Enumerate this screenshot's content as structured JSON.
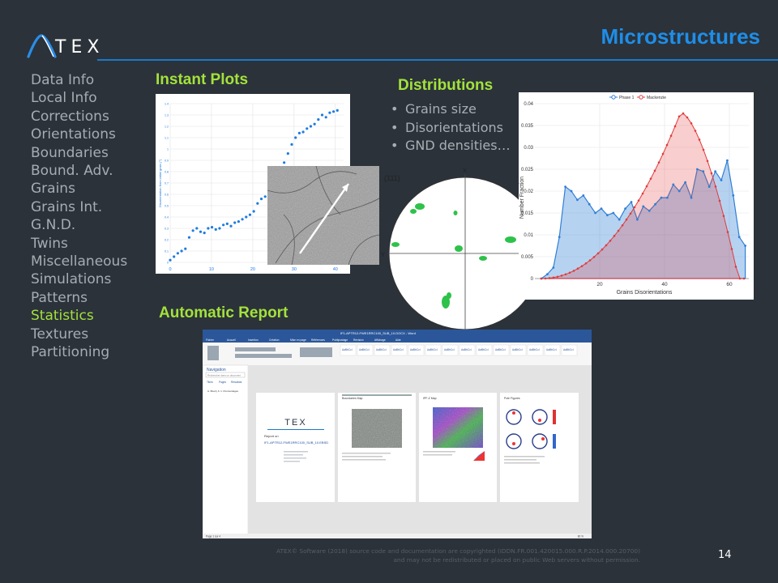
{
  "header": {
    "logo_text": "TEX",
    "title": "Microstructures"
  },
  "menu": {
    "items": [
      {
        "label": "Data Info"
      },
      {
        "label": "Local Info"
      },
      {
        "label": "Corrections"
      },
      {
        "label": "Orientations"
      },
      {
        "label": "Boundaries"
      },
      {
        "label": "Bound. Adv."
      },
      {
        "label": "Grains"
      },
      {
        "label": "Grains Int."
      },
      {
        "label": "G.N.D."
      },
      {
        "label": "Twins"
      },
      {
        "label": "Miscellaneous"
      },
      {
        "label": "Simulations"
      },
      {
        "label": "Patterns"
      },
      {
        "label": "Statistics",
        "active": true
      },
      {
        "label": "Textures"
      },
      {
        "label": "Partitioning"
      }
    ],
    "active_color": "#a3e23a"
  },
  "sections": {
    "instant_plots": "Instant Plots",
    "distributions": "Distributions",
    "automatic_report": "Automatic Report"
  },
  "distribution_bullets": [
    "Grains size",
    "Disorientations",
    "GND densities…"
  ],
  "pole_figure": {
    "label": "(111)",
    "x_axis": "X",
    "y_axis": "Y"
  },
  "chart_data": [
    {
      "type": "scatter",
      "x_ticks": [
        0,
        10,
        20,
        30,
        40
      ],
      "xlim": [
        0,
        42
      ],
      "ylim": [
        0,
        1.4
      ],
      "y_ticks": [
        0,
        0.1,
        0.2,
        0.3,
        0.4,
        0.5,
        0.6,
        0.7,
        0.8,
        0.9,
        1.0,
        1.1,
        1.2,
        1.3,
        1.4
      ],
      "color": "#1e7be0"
    },
    {
      "type": "area",
      "xlabel": "Grains Disorientations",
      "ylabel": "Number Fraction",
      "xlim": [
        0,
        66
      ],
      "ylim": [
        0,
        0.04
      ],
      "x_ticks": [
        20,
        40,
        60
      ],
      "y_ticks": [
        0,
        0.005,
        0.01,
        0.015,
        0.02,
        0.025,
        0.03,
        0.035,
        0.04
      ],
      "series": [
        {
          "name": "Phase 1",
          "color": "#2f7fd6"
        },
        {
          "name": "Mackenzie",
          "color": "#e23b3b"
        }
      ]
    }
  ],
  "report": {
    "word_title": "IF1-APTR12-FWE1RRC100_SUB_10.DOCX - Word",
    "nav_pane_title": "Navigation",
    "nav_search_placeholder": "Rechercher dans un document",
    "nav_tabs": [
      "Titres",
      "Pages",
      "Résultats"
    ],
    "nav_item": "A. Bouzy b. 1. Pourcentages",
    "ribbon_tabs": [
      "Fichier",
      "Accueil",
      "Insertion",
      "Création",
      "Mise en page",
      "Références",
      "Publipostage",
      "Révision",
      "Affichage",
      "Aide"
    ],
    "page1_logo": "TEX",
    "page1_report_label": "Report on",
    "page1_report_name": "IF1-APTR12-FWE1RRC100_SUB_10.EBSD",
    "page2_title": "Boundaries Map",
    "page3_title": "IPF-Z Map",
    "page4_title": "Pole Figures",
    "status_left": "Page 1 sur 4",
    "status_zoom": "80 %"
  },
  "footer": {
    "line1": "ATEX© Software (2018) source code and documentation are copyrighted (IDDN.FR.001.420015.000.R.P.2014.000.20700)",
    "line2": "and may not be redistributed or placed on public Web servers without permission."
  },
  "page_number": "14"
}
